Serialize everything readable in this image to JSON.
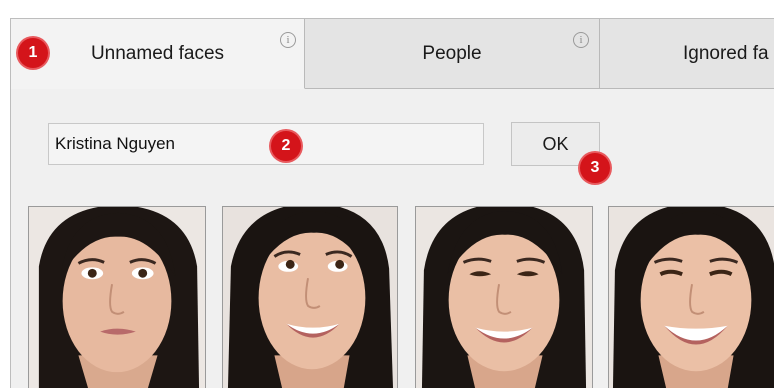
{
  "tabs": [
    {
      "label": "Unnamed faces",
      "info_icon": "info-icon",
      "active": true
    },
    {
      "label": "People",
      "info_icon": "info-icon",
      "active": false
    },
    {
      "label": "Ignored fa",
      "active": false
    }
  ],
  "name_form": {
    "name_value": "Kristina Nguyen",
    "ok_label": "OK"
  },
  "annotations": {
    "marker_1": "1",
    "marker_2": "2",
    "marker_3": "3"
  },
  "faces": {
    "count": 4,
    "expressions": [
      "neutral-pursed",
      "smile-looking-up",
      "smile",
      "broad-smile"
    ]
  },
  "colors": {
    "window_bg": "#f0f0f0",
    "tab_active_bg": "#f3f3f3",
    "tab_inactive_bg": "#e4e4e4",
    "marker_red": "#d4141a"
  }
}
